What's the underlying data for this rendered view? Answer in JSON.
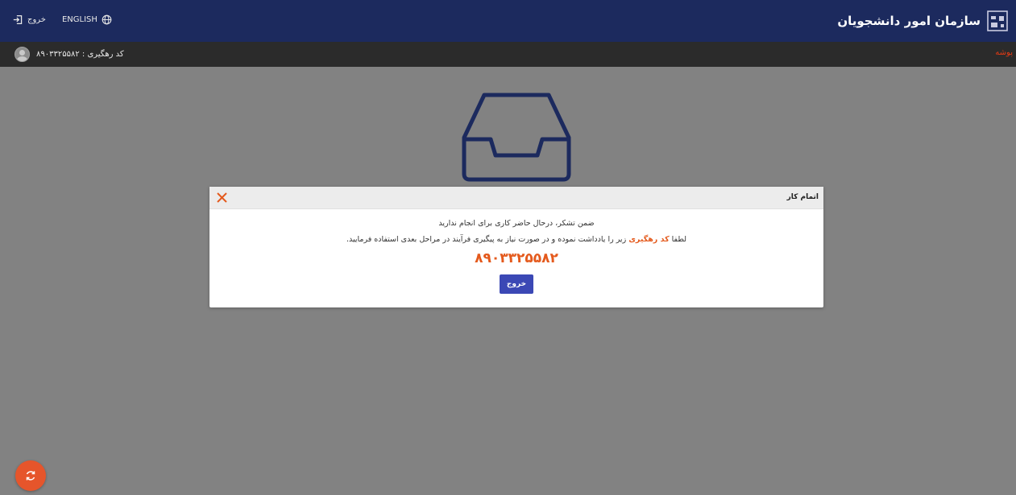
{
  "header": {
    "org_name": "سازمان امور دانشجویان",
    "language_label": "ENGLISH",
    "logout_label": "خروج"
  },
  "subheader": {
    "breadcrumb": "پوشه",
    "tracking_label": "کد رهگیری : ۸۹۰۳۳۲۵۵۸۲"
  },
  "modal": {
    "title": "اتمام کار",
    "message_line1": "ضمن تشکر، درحال حاضر کاری برای انجام ندارید",
    "message_line2_prefix": "لطفا",
    "message_line2_highlight": "کد رهگیری",
    "message_line2_suffix": "زیر را یادداشت نموده و در صورت نیاز به پیگیری فرآیند در مراحل بعدی استفاده فرمایید.",
    "tracking_code": "۸۹۰۳۳۲۵۵۸۲",
    "exit_button": "خروج"
  },
  "colors": {
    "header_bg": "#1c2a5e",
    "subheader_bg": "#2b2b2b",
    "overlay": "#828282",
    "accent": "#e45a1d",
    "button": "#3b48b5"
  },
  "icons": [
    "university-logo-icon",
    "globe-icon",
    "logout-icon",
    "avatar",
    "inbox-icon",
    "close-icon",
    "refresh-icon"
  ]
}
